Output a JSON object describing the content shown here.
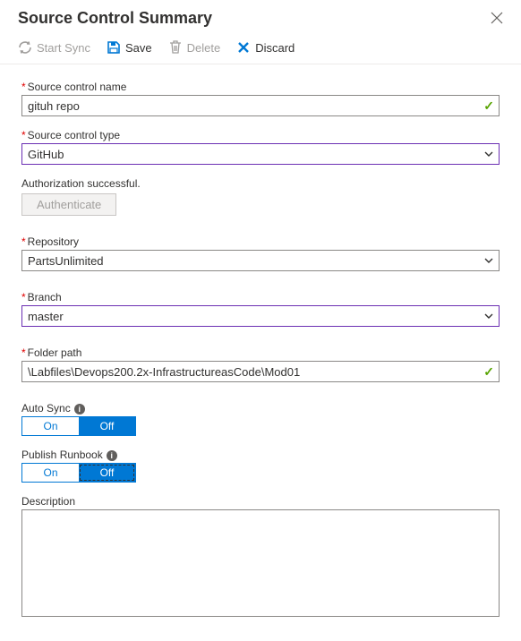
{
  "header": {
    "title": "Source Control Summary"
  },
  "toolbar": {
    "sync": "Start Sync",
    "save": "Save",
    "delete": "Delete",
    "discard": "Discard"
  },
  "fields": {
    "name": {
      "label": "Source control name",
      "value": "gituh repo"
    },
    "type": {
      "label": "Source control type",
      "value": "GitHub"
    },
    "auth": {
      "status": "Authorization successful.",
      "button": "Authenticate"
    },
    "repo": {
      "label": "Repository",
      "value": "PartsUnlimited"
    },
    "branch": {
      "label": "Branch",
      "value": "master"
    },
    "folder": {
      "label": "Folder path",
      "value": "\\Labfiles\\Devops200.2x-InfrastructureasCode\\Mod01"
    },
    "autosync": {
      "label": "Auto Sync",
      "on": "On",
      "off": "Off",
      "selected": "Off"
    },
    "publish": {
      "label": "Publish Runbook",
      "on": "On",
      "off": "Off",
      "selected": "Off"
    },
    "description": {
      "label": "Description",
      "value": ""
    }
  }
}
